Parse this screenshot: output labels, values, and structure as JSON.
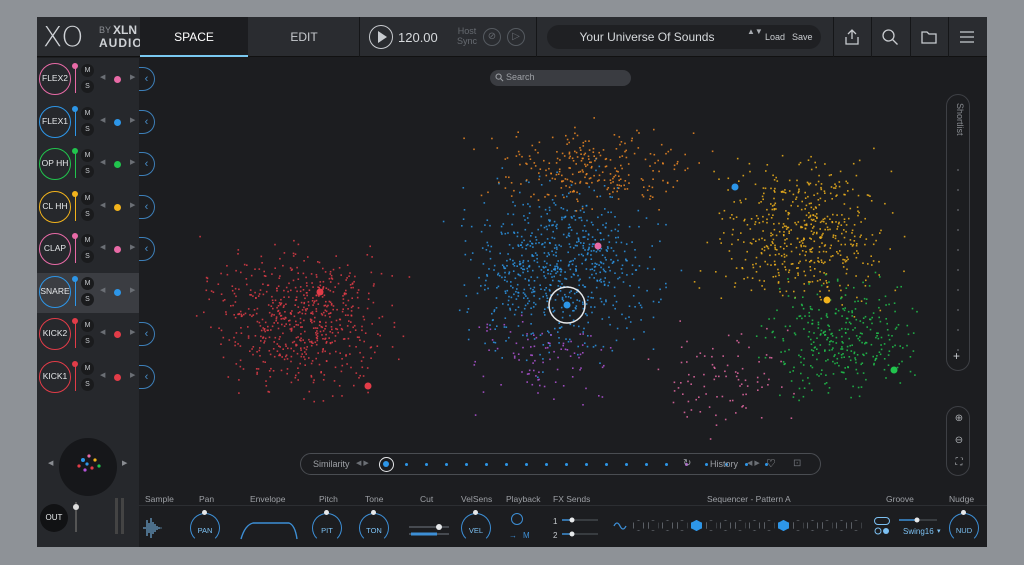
{
  "header": {
    "logo_xo": "XO",
    "logo_by": "BY",
    "logo_xln": "XLN",
    "logo_audio": "AUDIO",
    "tabs": [
      "SPACE",
      "EDIT"
    ],
    "tempo": "120.00",
    "host_sync": "Host Sync",
    "preset_name": "Your Universe Of Sounds",
    "preset_arrows": "▲▼",
    "load_label": "Load",
    "save_label": "Save"
  },
  "tracks": [
    {
      "name": "FLEX2",
      "color": "#e86aa6"
    },
    {
      "name": "FLEX1",
      "color": "#2d96e8"
    },
    {
      "name": "OP HH",
      "color": "#21c44d"
    },
    {
      "name": "CL HH",
      "color": "#f2b31c"
    },
    {
      "name": "CLAP",
      "color": "#e86aa6"
    },
    {
      "name": "SNARE",
      "color": "#2d96e8"
    },
    {
      "name": "KICK2",
      "color": "#e23c48"
    },
    {
      "name": "KICK1",
      "color": "#e23c48"
    }
  ],
  "track_button_m": "M",
  "track_button_s": "S",
  "arrow_left": "◀",
  "arrow_right": "▶",
  "expand_glyph": "‹",
  "out_label": "OUT",
  "search": {
    "placeholder": "Search"
  },
  "shortlist": {
    "label": "Shortlist",
    "add": "+"
  },
  "zoom_controls": {
    "in": "⊕",
    "out": "⊖",
    "fit": "⛶"
  },
  "similarity": {
    "label": "Similarity",
    "arrows": "◀ ▶",
    "steps": 20,
    "history_label": "History",
    "history_arrows": "◀ ▶",
    "history_icon": "↻",
    "heart_icon": "♡",
    "random_icon": "⊡"
  },
  "bottom": {
    "labels": [
      "Sample",
      "Pan",
      "Envelope",
      "Pitch",
      "Tone",
      "Cut",
      "VelSens",
      "Playback",
      "FX Sends",
      "Sequencer - Pattern A",
      "Groove",
      "Nudge"
    ],
    "knobs": {
      "pan": "PAN",
      "pit": "PIT",
      "ton": "TON",
      "vel": "VEL",
      "nud": "NUD"
    },
    "playback_m": "M",
    "fx_send_1": "1",
    "fx_send_2": "2",
    "swing": "Swing16"
  },
  "colors": {
    "pink": "#e86aa6",
    "blue": "#2d96e8",
    "green": "#21c44d",
    "yellow": "#f2b31c",
    "red": "#e23c48",
    "orange": "#f08a24",
    "purple": "#b354d8"
  }
}
